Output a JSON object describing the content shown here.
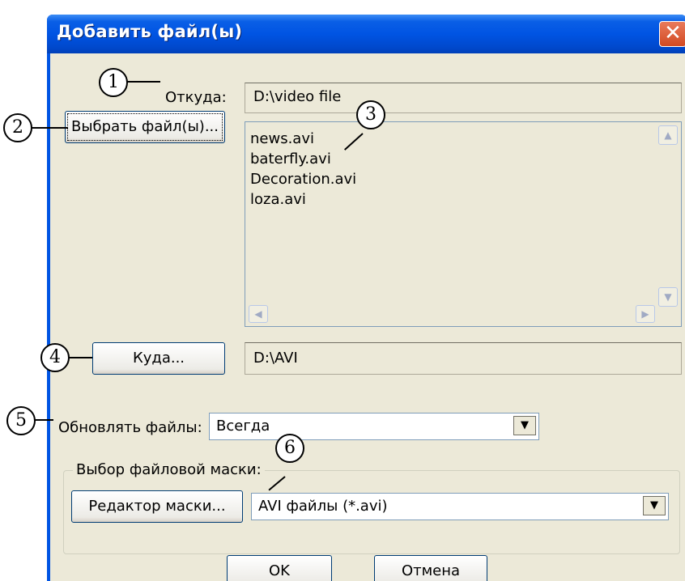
{
  "window": {
    "title": "Добавить файл(ы)",
    "close_glyph": "✕"
  },
  "source": {
    "label": "Откуда:",
    "path": "D:\\video file"
  },
  "select_button": {
    "label": "Выбрать файл(ы)..."
  },
  "file_list": {
    "items": [
      "news.avi",
      "baterfly.avi",
      "Decoration.avi",
      "loza.avi"
    ],
    "scroll_up": "▲",
    "scroll_down": "▼",
    "scroll_left": "◀",
    "scroll_right": "▶"
  },
  "destination": {
    "button_label": "Куда...",
    "path": "D:\\AVI"
  },
  "update": {
    "label": "Обновлять файлы:",
    "selected": "Всегда",
    "arrow": "▼"
  },
  "mask": {
    "group_label": "Выбор файловой маски:",
    "editor_button": "Редактор маски...",
    "selected": "AVI файлы (*.avi)",
    "arrow": "▼"
  },
  "buttons": {
    "ok": "OK",
    "cancel": "Отмена"
  },
  "callouts": [
    "1",
    "2",
    "3",
    "4",
    "5",
    "6"
  ]
}
